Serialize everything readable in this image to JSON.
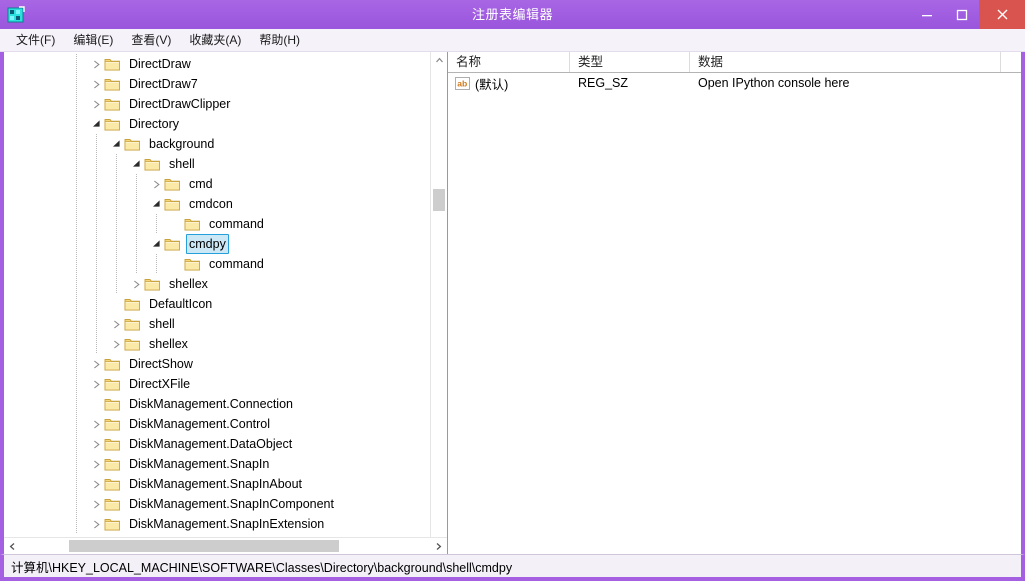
{
  "window": {
    "title": "注册表编辑器",
    "icon": "registry-editor-icon",
    "titlebar_color": "#a560e2",
    "close_color": "#d9534f",
    "buttons": {
      "minimize": "minimize-icon",
      "maximize": "maximize-icon",
      "close": "close-icon"
    }
  },
  "menubar": {
    "items": [
      {
        "label": "文件(F)",
        "name": "menu-file"
      },
      {
        "label": "编辑(E)",
        "name": "menu-edit"
      },
      {
        "label": "查看(V)",
        "name": "menu-view"
      },
      {
        "label": "收藏夹(A)",
        "name": "menu-favorites"
      },
      {
        "label": "帮助(H)",
        "name": "menu-help"
      }
    ]
  },
  "tree": {
    "selected": "cmdpy",
    "selection_bg": "#cce8f6",
    "selection_border": "#26a0da",
    "items": [
      {
        "label": "DirectDraw",
        "depth": 1,
        "twisty": "collapsed"
      },
      {
        "label": "DirectDraw7",
        "depth": 1,
        "twisty": "collapsed"
      },
      {
        "label": "DirectDrawClipper",
        "depth": 1,
        "twisty": "collapsed"
      },
      {
        "label": "Directory",
        "depth": 1,
        "twisty": "expanded"
      },
      {
        "label": "background",
        "depth": 2,
        "twisty": "expanded"
      },
      {
        "label": "shell",
        "depth": 3,
        "twisty": "expanded"
      },
      {
        "label": "cmd",
        "depth": 4,
        "twisty": "collapsed"
      },
      {
        "label": "cmdcon",
        "depth": 4,
        "twisty": "expanded"
      },
      {
        "label": "command",
        "depth": 5,
        "twisty": "none"
      },
      {
        "label": "cmdpy",
        "depth": 4,
        "twisty": "expanded",
        "selected": true
      },
      {
        "label": "command",
        "depth": 5,
        "twisty": "none"
      },
      {
        "label": "shellex",
        "depth": 3,
        "twisty": "collapsed"
      },
      {
        "label": "DefaultIcon",
        "depth": 2,
        "twisty": "none"
      },
      {
        "label": "shell",
        "depth": 2,
        "twisty": "collapsed"
      },
      {
        "label": "shellex",
        "depth": 2,
        "twisty": "collapsed"
      },
      {
        "label": "DirectShow",
        "depth": 1,
        "twisty": "collapsed"
      },
      {
        "label": "DirectXFile",
        "depth": 1,
        "twisty": "collapsed"
      },
      {
        "label": "DiskManagement.Connection",
        "depth": 1,
        "twisty": "none"
      },
      {
        "label": "DiskManagement.Control",
        "depth": 1,
        "twisty": "collapsed"
      },
      {
        "label": "DiskManagement.DataObject",
        "depth": 1,
        "twisty": "collapsed"
      },
      {
        "label": "DiskManagement.SnapIn",
        "depth": 1,
        "twisty": "collapsed"
      },
      {
        "label": "DiskManagement.SnapInAbout",
        "depth": 1,
        "twisty": "collapsed"
      },
      {
        "label": "DiskManagement.SnapInComponent",
        "depth": 1,
        "twisty": "collapsed"
      },
      {
        "label": "DiskManagement.SnapInExtension",
        "depth": 1,
        "twisty": "collapsed"
      }
    ],
    "scrollbars": {
      "vertical_arrow_up": "chevron-up-icon",
      "horizontal_arrow_left": "chevron-left-icon",
      "horizontal_arrow_right": "chevron-right-icon"
    }
  },
  "list": {
    "columns": [
      {
        "label": "名称",
        "name": "column-name"
      },
      {
        "label": "类型",
        "name": "column-type"
      },
      {
        "label": "数据",
        "name": "column-data"
      }
    ],
    "rows": [
      {
        "icon": "string-value-icon",
        "name": "(默认)",
        "type": "REG_SZ",
        "data": "Open IPython console here"
      }
    ]
  },
  "statusbar": {
    "path": "计算机\\HKEY_LOCAL_MACHINE\\SOFTWARE\\Classes\\Directory\\background\\shell\\cmdpy"
  }
}
